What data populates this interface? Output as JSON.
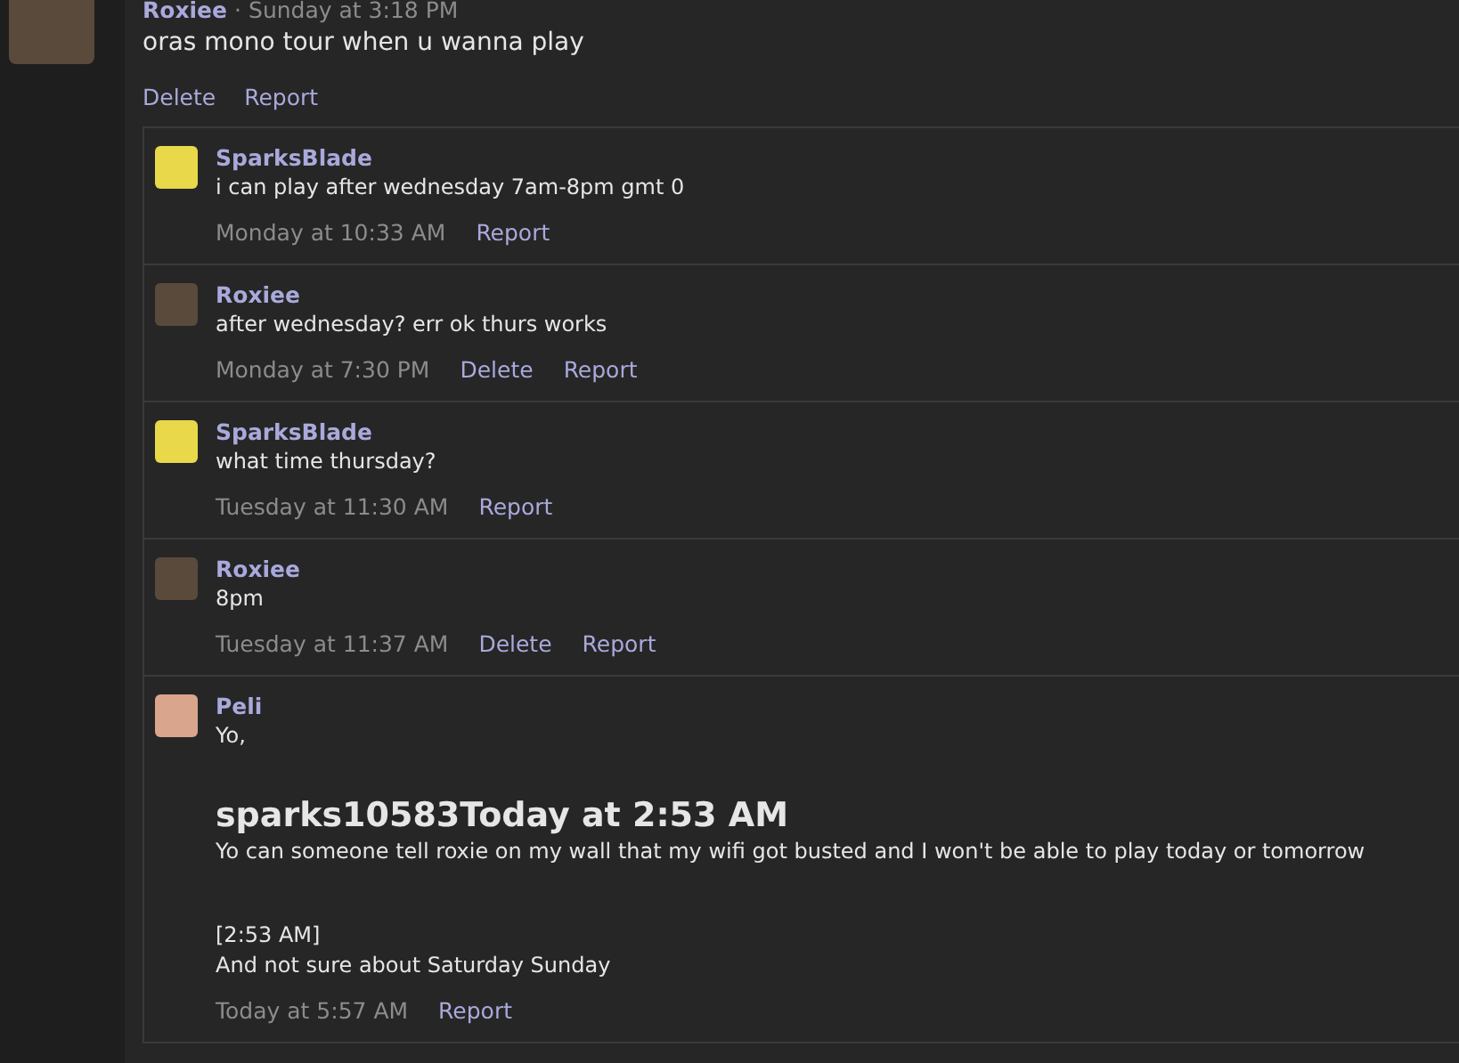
{
  "post": {
    "author": "Roxiee",
    "separator": "·",
    "time": "Sunday at 3:18 PM",
    "color": "#5a4a3c",
    "message": "oras mono tour when u wanna play",
    "actions": [
      "Delete",
      "Report"
    ]
  },
  "replies": [
    {
      "author": "SparksBlade",
      "color": "#e8d84a",
      "body": [
        {
          "kind": "text",
          "text": "i can play after wednesday 7am-8pm gmt 0"
        }
      ],
      "time": "Monday at 10:33 AM",
      "actions": [
        "Report"
      ]
    },
    {
      "author": "Roxiee",
      "color": "#5a4a3c",
      "body": [
        {
          "kind": "text",
          "text": "after wednesday? err ok thurs works"
        }
      ],
      "time": "Monday at 7:30 PM",
      "actions": [
        "Delete",
        "Report"
      ]
    },
    {
      "author": "SparksBlade",
      "color": "#e8d84a",
      "body": [
        {
          "kind": "text",
          "text": "what time thursday?"
        }
      ],
      "time": "Tuesday at 11:30 AM",
      "actions": [
        "Report"
      ]
    },
    {
      "author": "Roxiee",
      "color": "#5a4a3c",
      "body": [
        {
          "kind": "text",
          "text": "8pm"
        }
      ],
      "time": "Tuesday at 11:37 AM",
      "actions": [
        "Delete",
        "Report"
      ]
    },
    {
      "author": "Peli",
      "color": "#d9a58c",
      "body": [
        {
          "kind": "text",
          "text": "Yo,"
        },
        {
          "kind": "heading",
          "text": "sparks10583Today at 2:53 AM"
        },
        {
          "kind": "text",
          "text": "Yo can someone tell roxie on my wall that my wifi got busted and I won't be able to play today or tomorrow"
        },
        {
          "kind": "gaptext",
          "text": "[2:53 AM]"
        },
        {
          "kind": "text",
          "text": "And not sure about Saturday Sunday"
        }
      ],
      "time": "Today at 5:57 AM",
      "actions": [
        "Report"
      ]
    }
  ]
}
